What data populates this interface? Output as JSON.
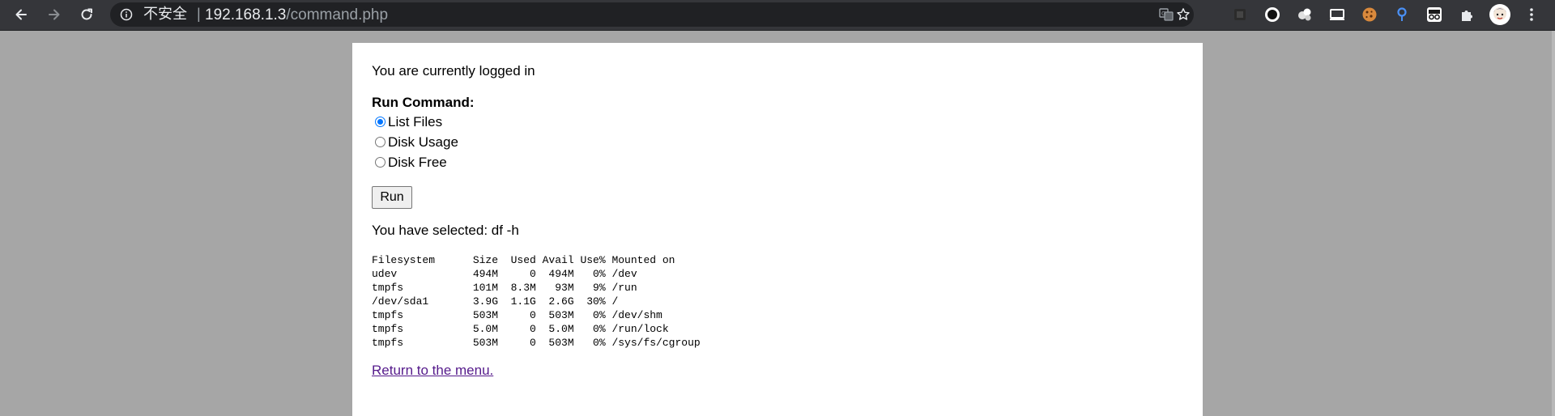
{
  "browser": {
    "security_label": "不安全",
    "separator": "|",
    "url_host": "192.168.1.3",
    "url_path": "/command.php",
    "icons": [
      "back-arrow-icon",
      "forward-arrow-icon",
      "reload-icon",
      "info-icon",
      "translate-icon",
      "star-icon",
      "extension-icons",
      "puzzle-icon",
      "profile-avatar",
      "more-menu-icon"
    ]
  },
  "page": {
    "login_status": "You are currently logged in",
    "form_heading": "Run Command:",
    "options": [
      {
        "label": "List Files",
        "checked": true
      },
      {
        "label": "Disk Usage",
        "checked": false
      },
      {
        "label": "Disk Free",
        "checked": false
      }
    ],
    "run_button": "Run",
    "selected_text": "You have selected: df -h",
    "output_header": "Filesystem      Size  Used Avail Use% Mounted on",
    "output_rows": [
      "udev            494M     0  494M   0% /dev",
      "tmpfs           101M  8.3M   93M   9% /run",
      "/dev/sda1       3.9G  1.1G  2.6G  30% /",
      "tmpfs           503M     0  503M   0% /dev/shm",
      "tmpfs           5.0M     0  5.0M   0% /run/lock",
      "tmpfs           503M     0  503M   0% /sys/fs/cgroup"
    ],
    "return_link": "Return to the menu."
  },
  "colors": {
    "toolbar_bg": "#35363a",
    "omnibox_bg": "#202124",
    "page_bg": "#a6a6a6",
    "link_visited": "#551a8b",
    "radio_accent": "#0075ff"
  }
}
